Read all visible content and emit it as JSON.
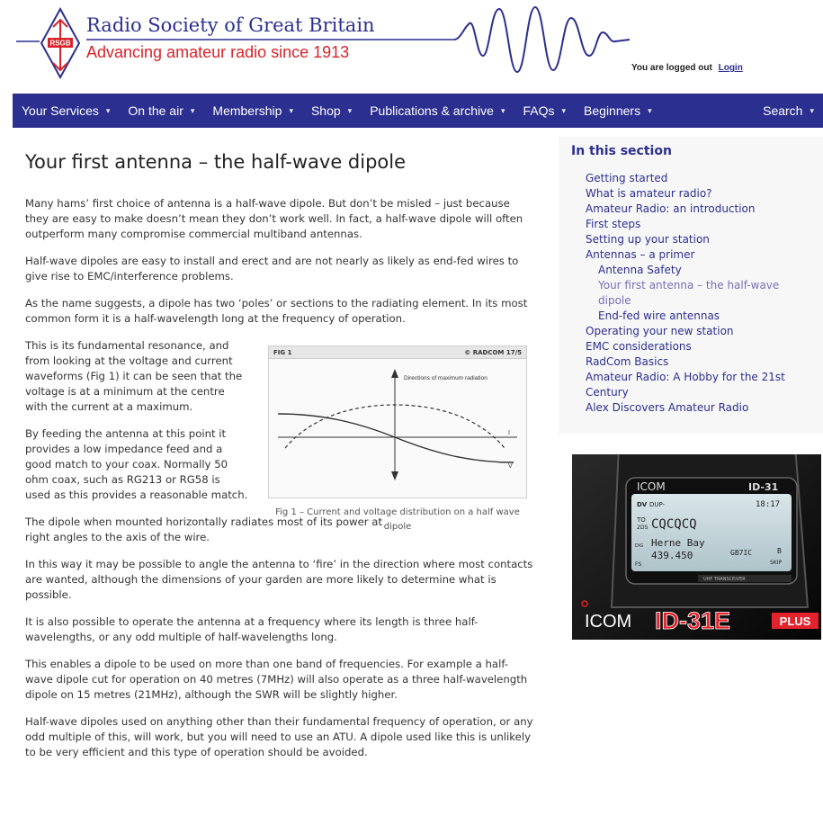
{
  "header": {
    "site_title": "Radio Society of Great Britain",
    "tagline": "Advancing amateur radio since 1913",
    "logo_text": "RSGB",
    "login_status": "You are logged out",
    "login_link": "Login"
  },
  "nav": {
    "items": [
      {
        "label": "Your Services"
      },
      {
        "label": "On the air"
      },
      {
        "label": "Membership"
      },
      {
        "label": "Shop"
      },
      {
        "label": "Publications & archive"
      },
      {
        "label": "FAQs"
      },
      {
        "label": "Beginners"
      },
      {
        "label": "Search"
      }
    ]
  },
  "main": {
    "title": "Your first antenna – the half-wave dipole",
    "paragraphs": [
      "Many hams’ first choice of antenna is a half-wave dipole. But don’t be misled – just because they are easy to make doesn’t mean they don’t work well. In fact, a half-wave dipole will often outperform many compromise commercial multiband antennas.",
      "Half-wave dipoles are easy to install and erect and are not nearly as likely as end-fed wires to give rise to EMC/interference problems.",
      "As the name suggests, a dipole has two ‘poles’ or sections to the radiating element. In its most common form it is a half-wavelength long at the frequency of operation.",
      "This is its fundamental resonance, and from looking at the voltage and current waveforms (Fig 1) it can be seen that the voltage is at a minimum at the centre with the current at a maximum.",
      "By feeding the antenna at this point it provides a low impedance feed and a good match to your coax. Normally 50 ohm coax, such as RG213 or RG58 is used as this provides a reasonable match.",
      "The dipole when mounted horizontally radiates most of its power at right angles to the axis of the wire.",
      "In this way it may be possible to angle the antenna to ‘fire’ in the direction where most contacts are wanted, although the dimensions of your garden are more likely to determine what is possible.",
      "It is also possible to operate the antenna at a frequency where its length is three half-wavelengths, or any odd multiple of half-wavelengths long.",
      "This enables a dipole to be used on more than one band of frequencies. For example a half-wave dipole cut for operation on 40 metres (7MHz) will also operate as a three half-wavelength dipole on 15 metres (21MHz), although the SWR will be slightly higher.",
      "Half-wave dipoles used on anything other than their fundamental frequency of operation, or any odd multiple of this, will work, but you will need to use an ATU. A dipole used like this is unlikely to be very efficient and this type of operation should be avoided."
    ],
    "figure": {
      "label": "FIG 1",
      "credit": "© RADCOM 17/5",
      "annotation": "Directions of maximum radiation",
      "label_i": "I",
      "label_v": "V",
      "caption": "Fig 1 – Current and voltage distribution on a half wave dipole"
    }
  },
  "sidebar": {
    "title": "In this section",
    "items": [
      {
        "label": "Getting started",
        "level": 1
      },
      {
        "label": "What is amateur radio?",
        "level": 1
      },
      {
        "label": "Amateur Radio: an introduction",
        "level": 1
      },
      {
        "label": "First steps",
        "level": 1
      },
      {
        "label": "Setting up your station",
        "level": 1
      },
      {
        "label": "Antennas – a primer",
        "level": 1
      },
      {
        "label": "Antenna Safety",
        "level": 2
      },
      {
        "label": "Your first antenna – the half-wave",
        "level": 2,
        "current": true
      },
      {
        "label": "dipole",
        "level": 2,
        "current": true
      },
      {
        "label": "End-fed wire antennas",
        "level": 2
      },
      {
        "label": "Operating your new station",
        "level": 1
      },
      {
        "label": "EMC considerations",
        "level": 1
      },
      {
        "label": "RadCom Basics",
        "level": 1
      },
      {
        "label": "Amateur Radio: A Hobby for the 21st",
        "level": 1
      },
      {
        "label": "Century",
        "level": 1
      },
      {
        "label": "Alex Discovers Amateur Radio",
        "level": 1
      }
    ]
  },
  "ad": {
    "brand": "ICOM",
    "model": "ID-31E",
    "model_suffix": "PLUS",
    "radio_model": "ID-31",
    "screen_time": "18:17",
    "screen_call": "CQCQCQ",
    "screen_place": "Herne Bay",
    "screen_freq": "439.450",
    "screen_callsign": "GB7IC",
    "screen_mode": "B",
    "screen_skip": "SKIP",
    "screen_dv": "DV",
    "screen_dup": "DUP-",
    "screen_to": "TO",
    "screen_2ds": "2DS",
    "screen_fs": "FS",
    "screen_stamp": "DIG",
    "band_label": "UHF TRANSCEIVER",
    "colors": {
      "accent": "#e4222c"
    }
  },
  "colors": {
    "brand_blue": "#2b2f8f",
    "brand_red": "#d8232a",
    "nav_bg": "#2b2f8f"
  }
}
